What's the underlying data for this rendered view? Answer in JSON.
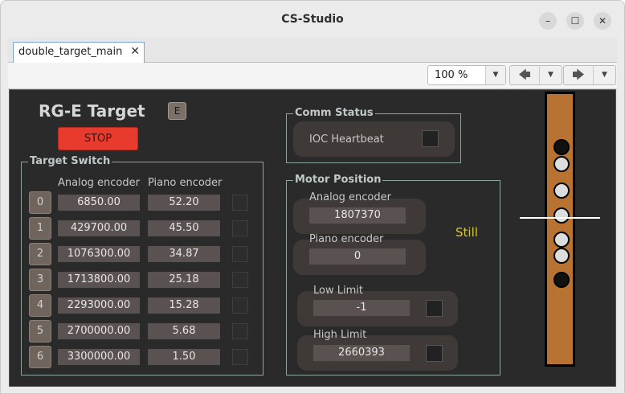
{
  "window": {
    "title": "CS-Studio"
  },
  "tabs": [
    {
      "label": "double_target_main",
      "close": "✕"
    }
  ],
  "toolbar": {
    "zoom": "100 %"
  },
  "panel": {
    "title": "RG-E Target",
    "e_button": "E",
    "stop_button": "STOP",
    "target_switch": {
      "label": "Target Switch",
      "col_analog": "Analog encoder",
      "col_piano": "Piano encoder",
      "rows": [
        {
          "index": "0",
          "analog": "6850.00",
          "piano": "52.20"
        },
        {
          "index": "1",
          "analog": "429700.00",
          "piano": "45.50"
        },
        {
          "index": "2",
          "analog": "1076300.00",
          "piano": "34.87"
        },
        {
          "index": "3",
          "analog": "1713800.00",
          "piano": "25.18"
        },
        {
          "index": "4",
          "analog": "2293000.00",
          "piano": "15.28"
        },
        {
          "index": "5",
          "analog": "2700000.00",
          "piano": "5.68"
        },
        {
          "index": "6",
          "analog": "3300000.00",
          "piano": "1.50"
        }
      ]
    },
    "comm_status": {
      "label": "Comm Status",
      "heartbeat": "IOC Heartbeat"
    },
    "motor_position": {
      "label": "Motor Position",
      "analog_label": "Analog encoder",
      "analog_value": "1807370",
      "piano_label": "Piano encoder",
      "piano_value": "0",
      "low_limit_label": "Low Limit",
      "low_limit_value": "-1",
      "high_limit_label": "High Limit",
      "high_limit_value": "2660393",
      "state": "Still"
    },
    "colors": {
      "stop": "#e93a2e",
      "target_bar": "#b87333",
      "still_text": "#d6c93a"
    }
  }
}
